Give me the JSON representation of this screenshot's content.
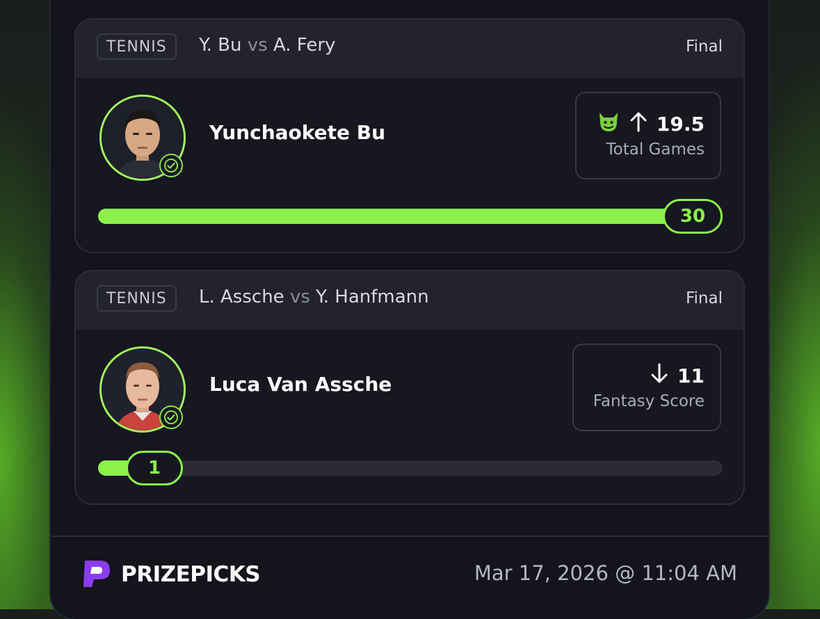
{
  "picks": [
    {
      "sport": "TENNIS",
      "team1": "Y. Bu",
      "vs": "vs",
      "team2": "A. Fery",
      "status": "Final",
      "player": "Yunchaokete Bu",
      "direction": "more",
      "line": "19.5",
      "stat": "Total Games",
      "result": "30",
      "progress_fraction": 1.0,
      "icons": [
        "demon-icon",
        "arrow-up-icon"
      ]
    },
    {
      "sport": "TENNIS",
      "team1": "L. Assche",
      "vs": "vs",
      "team2": "Y. Hanfmann",
      "status": "Final",
      "player": "Luca Van Assche",
      "direction": "less",
      "line": "11",
      "stat": "Fantasy Score",
      "result": "1",
      "progress_fraction": 0.09,
      "icons": [
        "arrow-down-icon"
      ]
    }
  ],
  "footer": {
    "brand": "PRIZEPICKS",
    "timestamp": "Mar 17, 2026 @ 11:04 AM"
  },
  "colors": {
    "accent": "#8cf24a",
    "card_bg": "#16171f",
    "header_bg": "#22232c",
    "brand_purple": "#8a3df0"
  }
}
